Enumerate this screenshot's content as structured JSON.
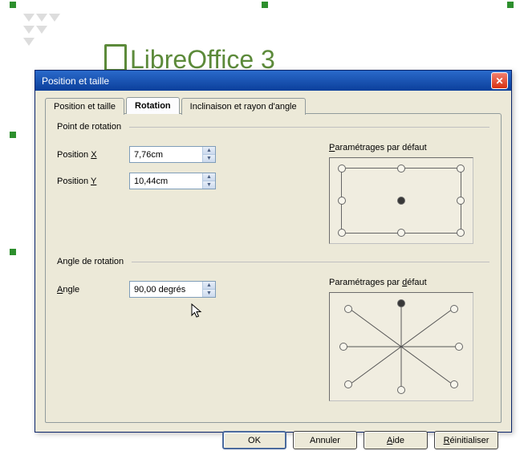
{
  "dialog": {
    "title": "Position et taille"
  },
  "tabs": {
    "pos": "Position et taille",
    "rot": "Rotation",
    "incl": "Inclinaison et rayon d'angle"
  },
  "group1": {
    "title": "Point de rotation",
    "posx_label_pre": "Position ",
    "posx_label_u": "X",
    "posx_value": "7,76cm",
    "posy_label_pre": "Position ",
    "posy_label_u": "Y",
    "posy_value": "10,44cm",
    "param_pre": "",
    "param_u": "P",
    "param_post": "aramétrages par défaut"
  },
  "group2": {
    "title": "Angle de rotation",
    "angle_label_u": "A",
    "angle_label_post": "ngle",
    "angle_value": "90,00 degrés",
    "param_pre": "Paramétrages par ",
    "param_u": "d",
    "param_post": "éfaut"
  },
  "buttons": {
    "ok": "OK",
    "cancel": "Annuler",
    "help": "Aide",
    "help_u": "A",
    "help_post": "ide",
    "reset": "Réinitialiser",
    "reset_u": "R",
    "reset_post": "éinitialiser"
  },
  "logo_text": "LibreOffice 3"
}
